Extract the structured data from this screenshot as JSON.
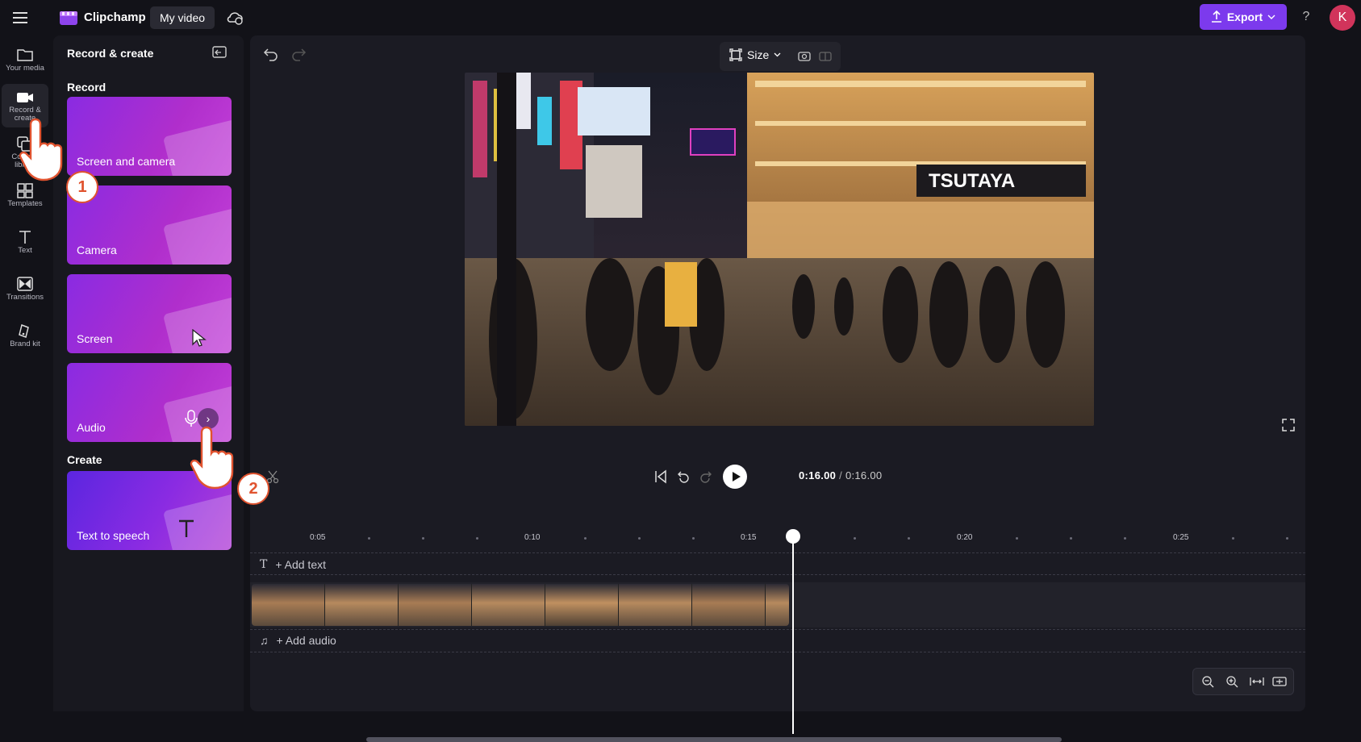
{
  "app": {
    "brand": "Clipchamp",
    "project_title": "My video",
    "export_label": "Export",
    "help": "?",
    "avatar_initial": "K"
  },
  "rail": {
    "items": [
      {
        "label": "Your media",
        "icon": "folder-icon"
      },
      {
        "label": "Record & create",
        "icon": "camera-icon"
      },
      {
        "label": "Content library",
        "icon": "content-library-icon"
      },
      {
        "label": "Templates",
        "icon": "templates-icon"
      },
      {
        "label": "Text",
        "icon": "text-icon"
      },
      {
        "label": "Transitions",
        "icon": "transitions-icon"
      },
      {
        "label": "Brand kit",
        "icon": "brand-kit-icon"
      }
    ]
  },
  "panel": {
    "title": "Record & create",
    "record_heading": "Record",
    "create_heading": "Create",
    "cards": [
      {
        "label": "Screen and camera"
      },
      {
        "label": "Camera"
      },
      {
        "label": "Screen"
      },
      {
        "label": "Audio"
      }
    ],
    "create_cards": [
      {
        "label": "Text to speech"
      }
    ]
  },
  "preview": {
    "size_label": "Size"
  },
  "timeline": {
    "current_time": "0:16.00",
    "total_time": "0:16.00",
    "ruler_labels": [
      "0:05",
      "0:10",
      "0:15",
      "0:20",
      "0:25"
    ],
    "add_text": "+ Add text",
    "add_audio": "+ Add audio"
  },
  "annotations": {
    "step1": "1",
    "step2": "2"
  },
  "colors": {
    "accent": "#7c3aed",
    "background": "#121218",
    "panel": "#18181f",
    "step_badge": "#e0532f",
    "avatar": "#d1345b"
  }
}
